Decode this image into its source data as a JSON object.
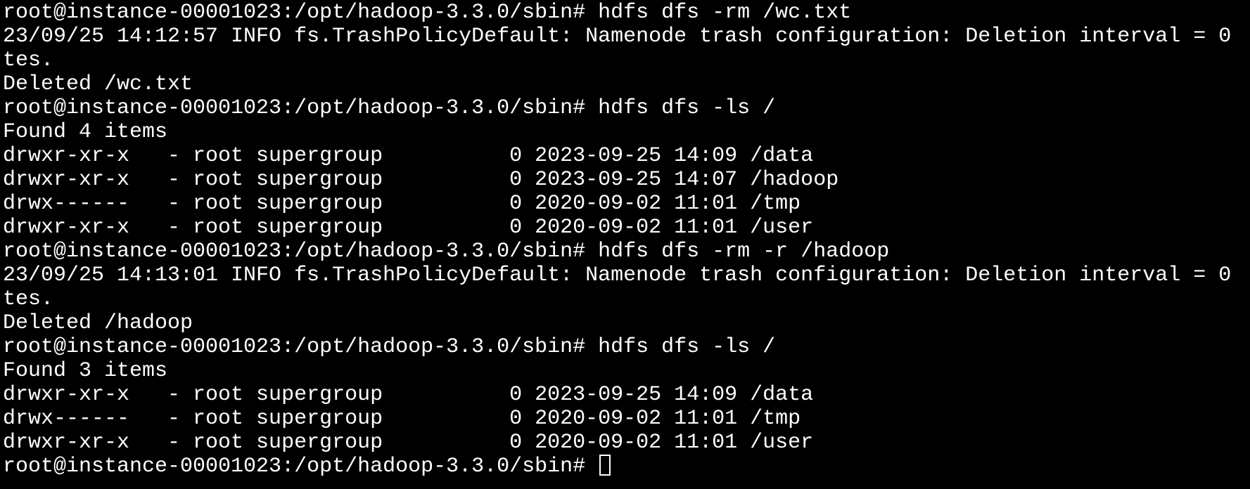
{
  "terminal": {
    "lines": [
      "root@instance-00001023:/opt/hadoop-3.3.0/sbin# hdfs dfs -rm /wc.txt",
      "23/09/25 14:12:57 INFO fs.TrashPolicyDefault: Namenode trash configuration: Deletion interval = 0",
      "tes.",
      "Deleted /wc.txt",
      "root@instance-00001023:/opt/hadoop-3.3.0/sbin# hdfs dfs -ls /",
      "Found 4 items",
      "drwxr-xr-x   - root supergroup          0 2023-09-25 14:09 /data",
      "drwxr-xr-x   - root supergroup          0 2023-09-25 14:07 /hadoop",
      "drwx------   - root supergroup          0 2020-09-02 11:01 /tmp",
      "drwxr-xr-x   - root supergroup          0 2020-09-02 11:01 /user",
      "root@instance-00001023:/opt/hadoop-3.3.0/sbin# hdfs dfs -rm -r /hadoop",
      "23/09/25 14:13:01 INFO fs.TrashPolicyDefault: Namenode trash configuration: Deletion interval = 0",
      "tes.",
      "Deleted /hadoop",
      "root@instance-00001023:/opt/hadoop-3.3.0/sbin# hdfs dfs -ls /",
      "Found 3 items",
      "drwxr-xr-x   - root supergroup          0 2023-09-25 14:09 /data",
      "drwx------   - root supergroup          0 2020-09-02 11:01 /tmp",
      "drwxr-xr-x   - root supergroup          0 2020-09-02 11:01 /user"
    ],
    "prompt": "root@instance-00001023:/opt/hadoop-3.3.0/sbin# "
  },
  "colors": {
    "background": "#000000",
    "foreground": "#ffffff"
  }
}
